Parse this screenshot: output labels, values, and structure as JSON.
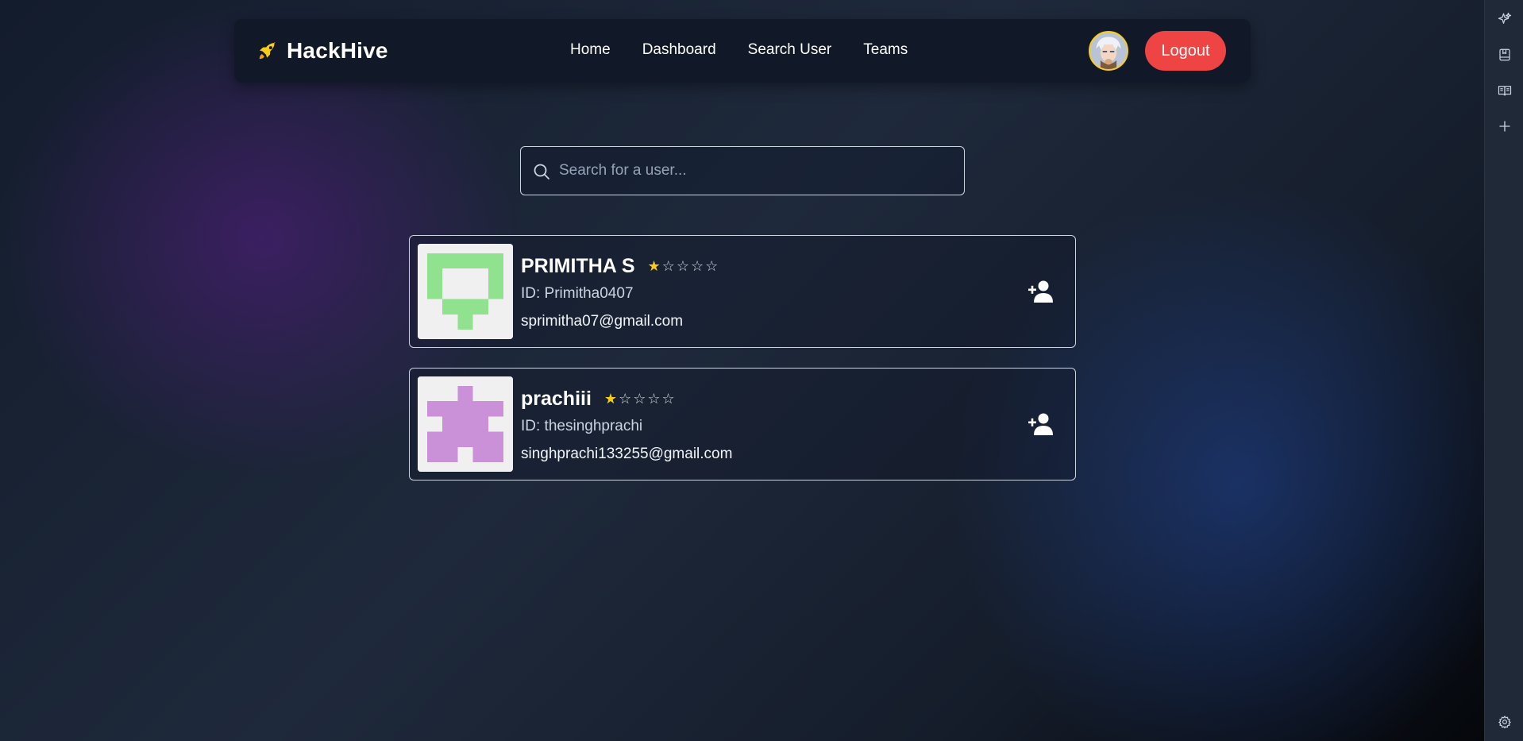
{
  "navbar": {
    "brand": "HackHive",
    "links": [
      "Home",
      "Dashboard",
      "Search User",
      "Teams"
    ],
    "logout_label": "Logout"
  },
  "search": {
    "placeholder": "Search for a user..."
  },
  "users": [
    {
      "name": "PRIMITHA S",
      "id_text": "ID: Primitha0407",
      "email": "sprimitha07@gmail.com",
      "rating": 1,
      "rating_max": 5,
      "avatar_color": "#90e28f"
    },
    {
      "name": "prachiii",
      "id_text": "ID: thesinghprachi",
      "email": "singhprachi133255@gmail.com",
      "rating": 1,
      "rating_max": 5,
      "avatar_color": "#cb91d8"
    }
  ],
  "colors": {
    "accent": "#ef4444",
    "star": "#facc15",
    "navbar_bg": "#111827"
  }
}
